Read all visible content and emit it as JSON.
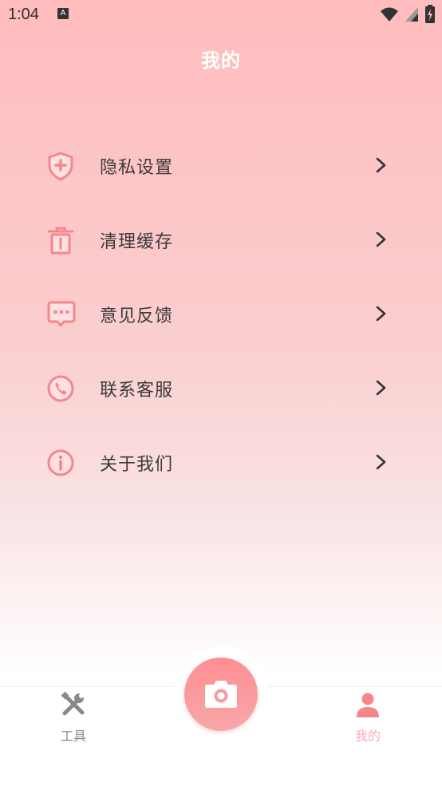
{
  "status_bar": {
    "time": "1:04",
    "notification_letter": "A",
    "icons": [
      "wifi-icon",
      "signal-icon",
      "battery-icon"
    ]
  },
  "header": {
    "title": "我的"
  },
  "menu": {
    "items": [
      {
        "label": "隐私设置",
        "icon": "shield-plus-icon"
      },
      {
        "label": "清理缓存",
        "icon": "trash-icon"
      },
      {
        "label": "意见反馈",
        "icon": "chat-bubble-icon"
      },
      {
        "label": "联系客服",
        "icon": "phone-icon"
      },
      {
        "label": "关于我们",
        "icon": "info-icon"
      }
    ]
  },
  "bottom_nav": {
    "tabs": [
      {
        "label": "工具",
        "icon": "tools-icon",
        "active": false
      },
      {
        "label": "我的",
        "icon": "person-icon",
        "active": true
      }
    ],
    "center_button_icon": "camera-icon"
  },
  "colors": {
    "accent": "#f5868b",
    "accent_light": "#f6b0b4",
    "header_top": "#ffbcbd",
    "text_primary": "#3a3a3a",
    "inactive_tab": "#8a8a8a"
  }
}
